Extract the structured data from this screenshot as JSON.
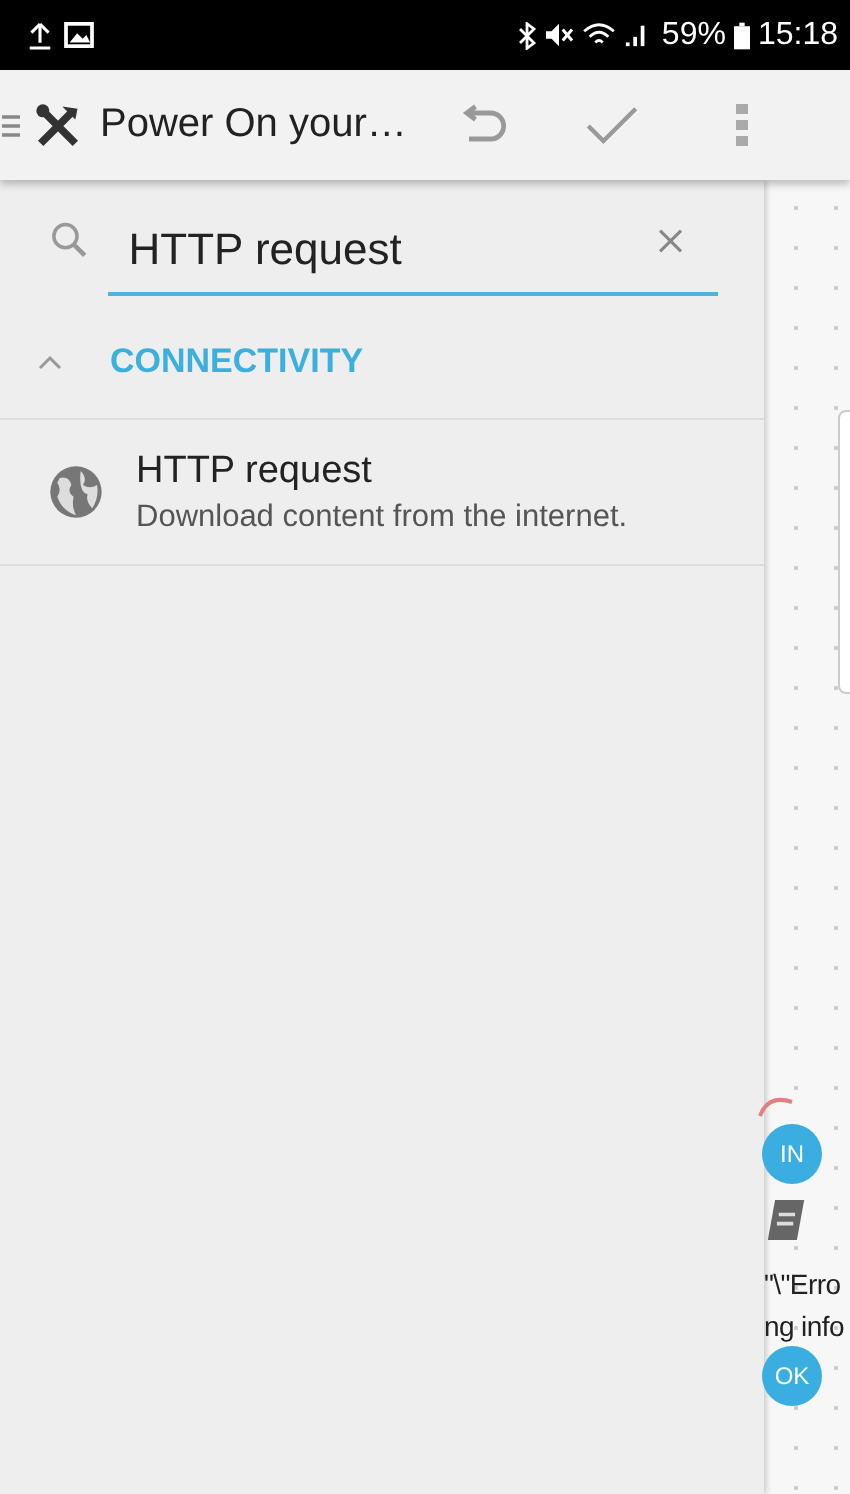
{
  "status_bar": {
    "battery": "59%",
    "time": "15:18"
  },
  "toolbar": {
    "title": "Power On your…"
  },
  "search": {
    "value": "HTTP request"
  },
  "categories": [
    {
      "title": "CONNECTIVITY",
      "expanded": true,
      "items": [
        {
          "title": "HTTP request",
          "description": "Download content from the internet."
        }
      ]
    }
  ],
  "canvas": {
    "ports": [
      {
        "label": "IN"
      },
      {
        "label": "OK"
      }
    ],
    "block_text": [
      "\"\\\"Erro",
      "ng info"
    ]
  }
}
